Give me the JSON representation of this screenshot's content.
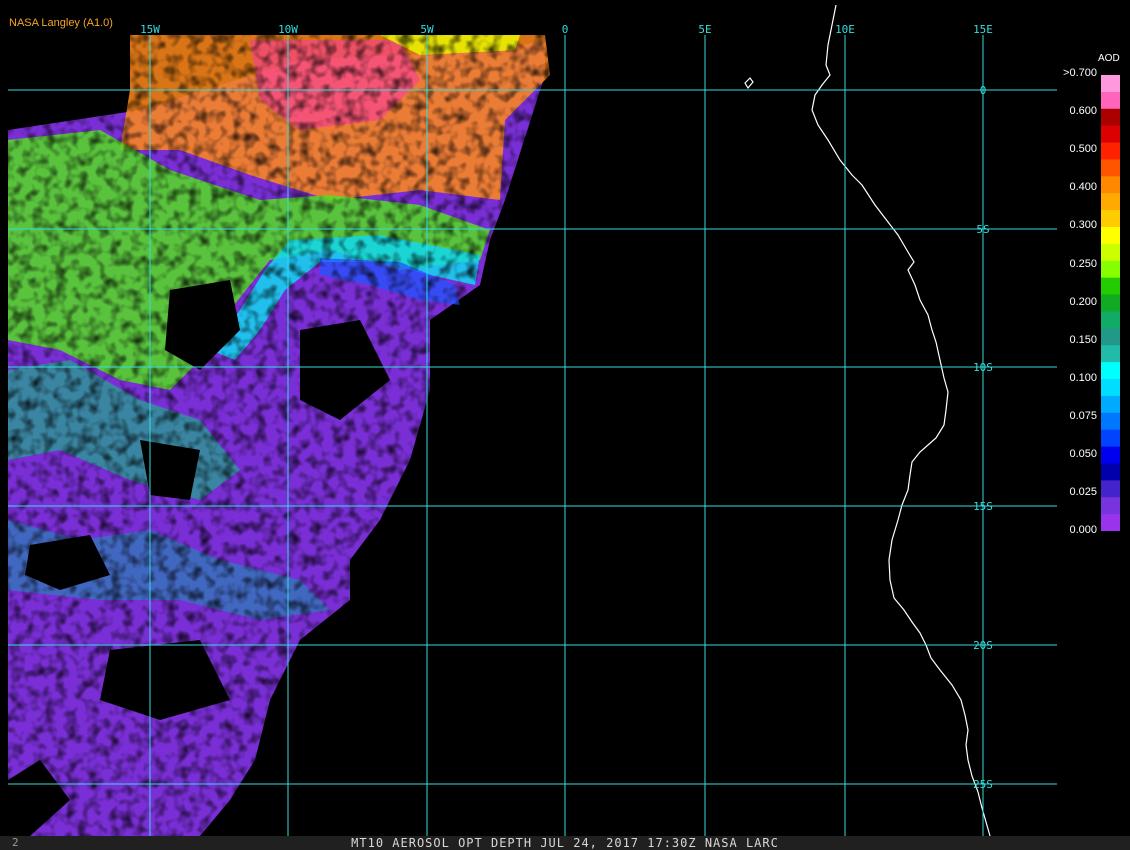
{
  "credit": "NASA Langley (A1.0)",
  "footer": {
    "text": "MT10  AEROSOL OPT DEPTH   JUL 24, 2017 17:30Z   NASA LARC",
    "mark": "2"
  },
  "colorbar": {
    "title": "AOD",
    "labels": [
      ">0.700",
      "0.600",
      "0.500",
      "0.400",
      "0.300",
      "0.250",
      "0.200",
      "0.150",
      "0.100",
      "0.075",
      "0.050",
      "0.025",
      "0.000"
    ],
    "colors": [
      "#ff99dd",
      "#ff66bb",
      "#aa0000",
      "#dd0000",
      "#ff2200",
      "#ff5500",
      "#ff8800",
      "#ffaa00",
      "#ffcc00",
      "#ffff00",
      "#ccff00",
      "#88ff00",
      "#22cc00",
      "#11aa22",
      "#11aa66",
      "#229988",
      "#22bbaa",
      "#00ffff",
      "#00ddff",
      "#00aaff",
      "#0077ff",
      "#0044ff",
      "#0000ee",
      "#0000aa",
      "#4422cc",
      "#7733dd",
      "#9933ee"
    ]
  },
  "lon_labels": [
    "15W",
    "10W",
    "5W",
    "0",
    "5E",
    "10E",
    "15E"
  ],
  "lat_labels": [
    "0",
    "5S",
    "10S",
    "15S",
    "20S",
    "25S"
  ],
  "grid_color": "#33dddd"
}
